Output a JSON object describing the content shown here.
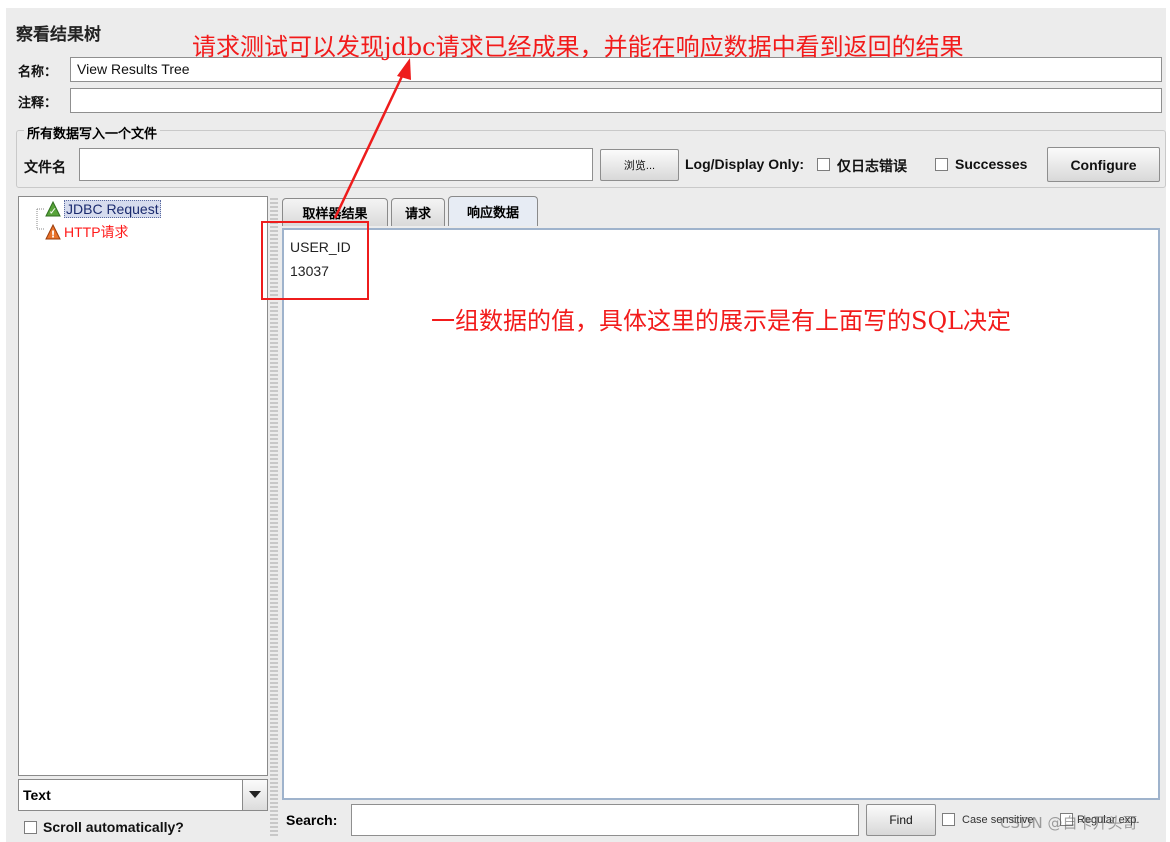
{
  "panel": {
    "title": "察看结果树",
    "name_label": "名称：",
    "name_value": "View Results Tree",
    "comment_label": "注释：",
    "comment_value": ""
  },
  "file_section": {
    "legend": "所有数据写入一个文件",
    "filename_label": "文件名",
    "filename_value": "",
    "browse_label": "浏览...",
    "log_display_label": "Log/Display Only:",
    "errors_only_label": "仅日志错误",
    "successes_label": "Successes",
    "configure_label": "Configure"
  },
  "tree": {
    "items": [
      {
        "label": "JDBC Request",
        "status": "success",
        "icon": "success-triangle-icon",
        "color": "#1a2a6e",
        "selected": true
      },
      {
        "label": "HTTP请求",
        "status": "error",
        "icon": "warning-triangle-icon",
        "color": "#ff1a1a",
        "selected": false
      }
    ],
    "renderer_value": "Text",
    "scroll_auto_label": "Scroll automatically?"
  },
  "tabs": [
    {
      "label": "取样器结果",
      "active": false
    },
    {
      "label": "请求",
      "active": false
    },
    {
      "label": "响应数据",
      "active": true
    }
  ],
  "response": {
    "lines": [
      "USER_ID",
      "13037"
    ]
  },
  "search": {
    "label": "Search:",
    "value": "",
    "find_label": "Find",
    "case_sensitive_label": "Case sensitive",
    "regex_label": "Regular exp."
  },
  "annotations": {
    "top_note": "请求测试可以发现jdbc请求已经成果，并能在响应数据中看到返回的结果",
    "middle_note": "一组数据的值，具体这里的展示是有上面写的SQL决定",
    "color": "#f21b1b"
  },
  "watermark": "CSDN @自卡开头哥"
}
